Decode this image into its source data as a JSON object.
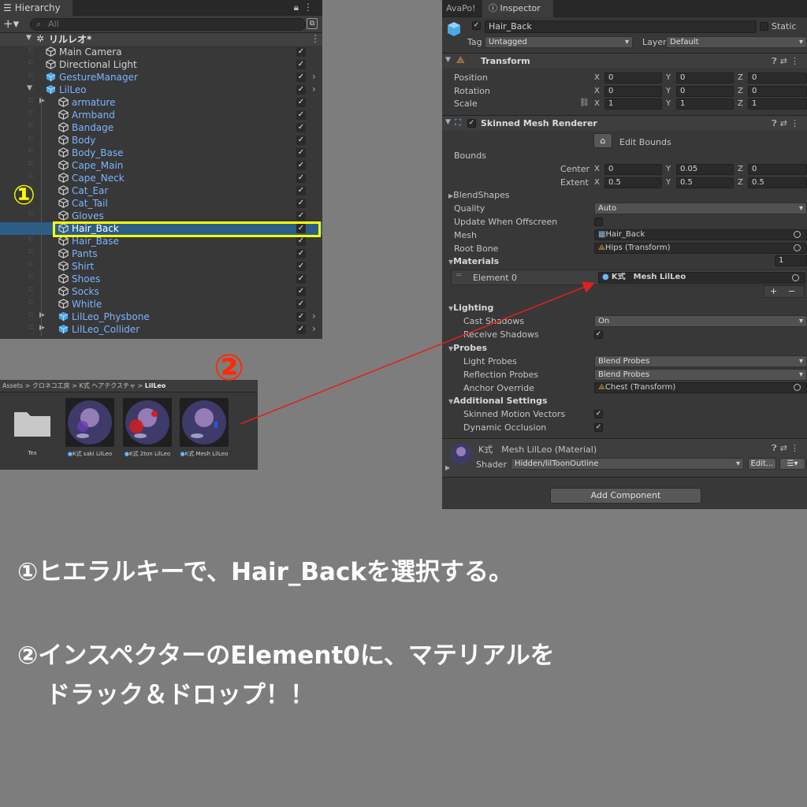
{
  "hierarchy": {
    "tab_title": "Hierarchy",
    "search_placeholder": "All",
    "scene_name": "リルレオ*",
    "items": [
      {
        "label": "Main Camera",
        "depth": 1,
        "type": "go",
        "expand": false,
        "prefab": false,
        "more": false
      },
      {
        "label": "Directional Light",
        "depth": 1,
        "type": "go",
        "expand": false,
        "prefab": false,
        "more": false
      },
      {
        "label": "GestureManager",
        "depth": 1,
        "type": "prefab",
        "expand": false,
        "prefab": true,
        "more": true
      },
      {
        "label": "LilLeo",
        "depth": 1,
        "type": "prefab-root",
        "expand": true,
        "prefab": true,
        "more": true
      },
      {
        "label": "armature",
        "depth": 2,
        "type": "go",
        "expand": true,
        "prefab": true,
        "more": false
      },
      {
        "label": "Armband",
        "depth": 2,
        "type": "go",
        "expand": false,
        "prefab": true,
        "more": false
      },
      {
        "label": "Bandage",
        "depth": 2,
        "type": "go",
        "expand": false,
        "prefab": true,
        "more": false
      },
      {
        "label": "Body",
        "depth": 2,
        "type": "go",
        "expand": false,
        "prefab": true,
        "more": false
      },
      {
        "label": "Body_Base",
        "depth": 2,
        "type": "go",
        "expand": false,
        "prefab": true,
        "more": false
      },
      {
        "label": "Cape_Main",
        "depth": 2,
        "type": "go",
        "expand": false,
        "prefab": true,
        "more": false
      },
      {
        "label": "Cape_Neck",
        "depth": 2,
        "type": "go",
        "expand": false,
        "prefab": true,
        "more": false
      },
      {
        "label": "Cat_Ear",
        "depth": 2,
        "type": "go",
        "expand": false,
        "prefab": true,
        "more": false
      },
      {
        "label": "Cat_Tail",
        "depth": 2,
        "type": "go",
        "expand": false,
        "prefab": true,
        "more": false
      },
      {
        "label": "Gloves",
        "depth": 2,
        "type": "go",
        "expand": false,
        "prefab": true,
        "more": false
      },
      {
        "label": "Hair_Back",
        "depth": 2,
        "type": "go",
        "expand": false,
        "prefab": true,
        "more": false,
        "selected": true
      },
      {
        "label": "Hair_Base",
        "depth": 2,
        "type": "go",
        "expand": false,
        "prefab": true,
        "more": false
      },
      {
        "label": "Pants",
        "depth": 2,
        "type": "go",
        "expand": false,
        "prefab": true,
        "more": false
      },
      {
        "label": "Shirt",
        "depth": 2,
        "type": "go",
        "expand": false,
        "prefab": true,
        "more": false
      },
      {
        "label": "Shoes",
        "depth": 2,
        "type": "go",
        "expand": false,
        "prefab": true,
        "more": false
      },
      {
        "label": "Socks",
        "depth": 2,
        "type": "go",
        "expand": false,
        "prefab": true,
        "more": false
      },
      {
        "label": "Whitle",
        "depth": 2,
        "type": "go",
        "expand": false,
        "prefab": true,
        "more": false
      },
      {
        "label": "LilLeo_Physbone",
        "depth": 2,
        "type": "prefab",
        "expand": true,
        "prefab": true,
        "more": true
      },
      {
        "label": "LilLeo_Collider",
        "depth": 2,
        "type": "prefab",
        "expand": true,
        "prefab": true,
        "more": true
      }
    ]
  },
  "project": {
    "breadcrumb": [
      "Assets",
      "クロネコ工房",
      "K式 ヘアテクスチャ",
      "LilLeo"
    ],
    "assets": [
      {
        "caption": "Tex",
        "kind": "folder"
      },
      {
        "caption": "K式 saki LilLeo",
        "kind": "material",
        "accent": "#6a3fb0"
      },
      {
        "caption": "K式 2ton LilLeo",
        "kind": "material",
        "accent": "#d11f1f"
      },
      {
        "caption": "K式 Mesh LilLeo",
        "kind": "material",
        "accent": "#2b55e0"
      }
    ]
  },
  "inspector": {
    "tabs": [
      "AvaPo!",
      "Inspector"
    ],
    "object_name": "Hair_Back",
    "static_label": "Static",
    "tag_label": "Tag",
    "tag_value": "Untagged",
    "layer_label": "Layer",
    "layer_value": "Default",
    "transform": {
      "title": "Transform",
      "rows": [
        {
          "label": "Position",
          "x": "0",
          "y": "0",
          "z": "0"
        },
        {
          "label": "Rotation",
          "x": "0",
          "y": "0",
          "z": "0"
        },
        {
          "label": "Scale",
          "x": "1",
          "y": "1",
          "z": "1"
        }
      ]
    },
    "smr": {
      "title": "Skinned Mesh Renderer",
      "edit_bounds": "Edit Bounds",
      "bounds_label": "Bounds",
      "center_label": "Center",
      "center": {
        "x": "0",
        "y": "0.05",
        "z": "0"
      },
      "extent_label": "Extent",
      "extent": {
        "x": "0.5",
        "y": "0.5",
        "z": "0.5"
      },
      "blendshapes": "BlendShapes",
      "quality_label": "Quality",
      "quality_value": "Auto",
      "update_offscreen": "Update When Offscreen",
      "mesh_label": "Mesh",
      "mesh_value": "Hair_Back",
      "root_bone_label": "Root Bone",
      "root_bone_value": "Hips (Transform)",
      "materials_label": "Materials",
      "materials_count": "1",
      "element_label": "Element 0",
      "element_value": "K式　Mesh LilLeo",
      "lighting": "Lighting",
      "cast_shadows_label": "Cast Shadows",
      "cast_shadows_value": "On",
      "receive_shadows": "Receive Shadows",
      "probes": "Probes",
      "light_probes_label": "Light Probes",
      "light_probes_value": "Blend Probes",
      "reflection_probes_label": "Reflection Probes",
      "reflection_probes_value": "Blend Probes",
      "anchor_label": "Anchor Override",
      "anchor_value": "Chest (Transform)",
      "additional": "Additional Settings",
      "skinned_motion": "Skinned Motion Vectors",
      "dynamic_occlusion": "Dynamic Occlusion"
    },
    "material": {
      "title": "K式　Mesh LilLeo (Material)",
      "shader_label": "Shader",
      "shader_value": "Hidden/lilToonOutline",
      "edit_label": "Edit..."
    },
    "add_component": "Add Component"
  },
  "annotations": {
    "step1_marker": "①",
    "step2_marker": "②",
    "instruction1": "①ヒエラルキーで、Hair_Backを選択する。",
    "instruction2_line1": "②インスペクターのElement0に、マテリアルを",
    "instruction2_line2": "ドラック＆ドロップ！！",
    "highlight_color": "#ffff00",
    "arrow_color": "#e02020"
  },
  "colors": {
    "prefab_text": "#7cb4ff",
    "normal_text": "#d2d2d2",
    "selection": "#2c5d87",
    "panel": "#383838",
    "background": "#7d7d7d"
  }
}
